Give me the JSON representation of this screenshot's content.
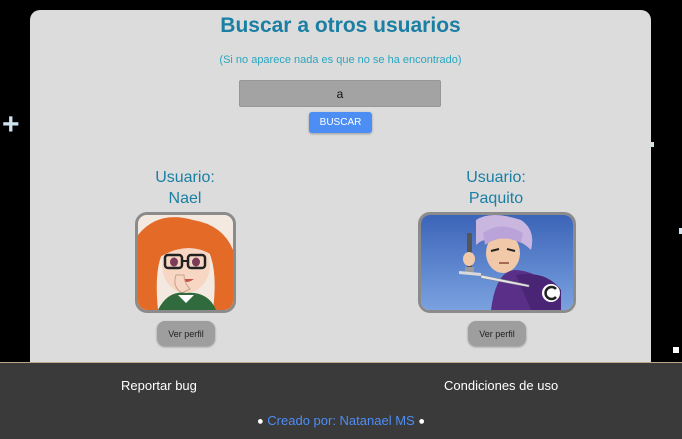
{
  "search": {
    "title": "Buscar a otros usuarios",
    "subtitle": "(Si no aparece nada es que no se ha encontrado)",
    "query_value": "a",
    "button_label": "BUSCAR"
  },
  "results": [
    {
      "label_prefix": "Usuario:",
      "username": "Nael",
      "button_label": "Ver perfil"
    },
    {
      "label_prefix": "Usuario:",
      "username": "Paquito",
      "button_label": "Ver perfil"
    }
  ],
  "footer": {
    "report_bug": "Reportar bug",
    "terms": "Condiciones de uso",
    "credit": "Creado por: Natanael MS"
  },
  "colors": {
    "title": "#1a7fa3",
    "accent": "#4d8ef5",
    "card_background": "#dcdcdc",
    "footer_background": "#3a3a3a"
  }
}
